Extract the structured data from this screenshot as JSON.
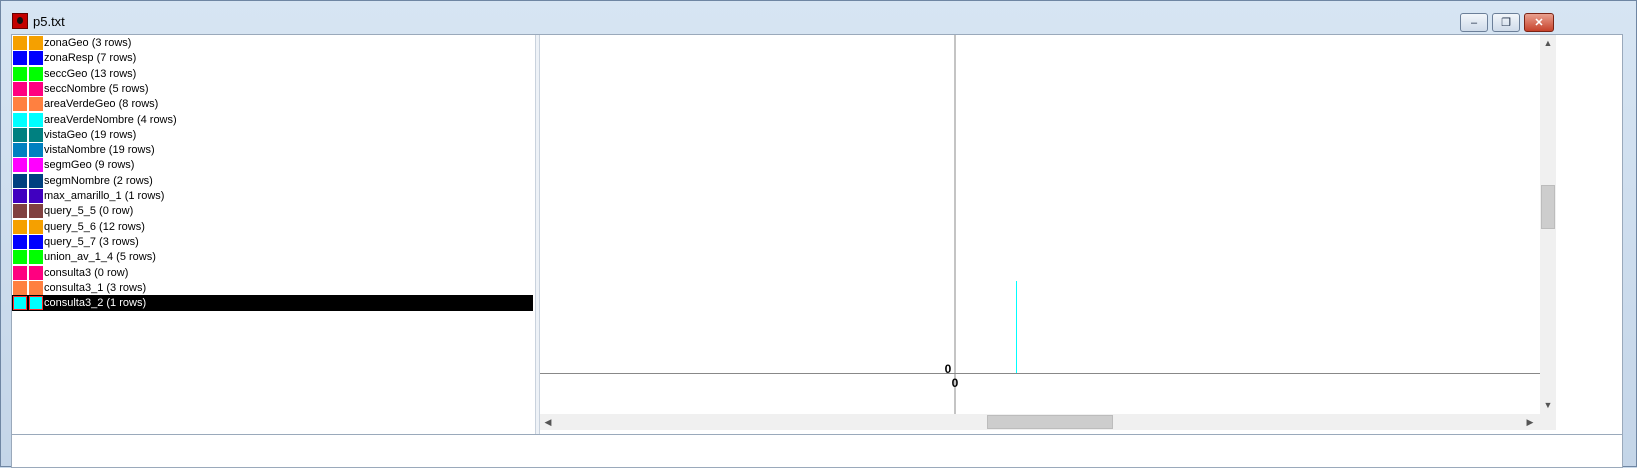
{
  "window": {
    "title": "p5.txt"
  },
  "controls": {
    "minimize": "–",
    "restore": "❐",
    "close": "✕"
  },
  "layers": [
    {
      "label": "zonaGeo (3 rows)",
      "color": "#f5a000"
    },
    {
      "label": "zonaResp (7 rows)",
      "color": "#0000ff"
    },
    {
      "label": "seccGeo (13 rows)",
      "color": "#00ff00"
    },
    {
      "label": "seccNombre (5 rows)",
      "color": "#ff0080"
    },
    {
      "label": "areaVerdeGeo (8 rows)",
      "color": "#ff8040"
    },
    {
      "label": "areaVerdeNombre (4 rows)",
      "color": "#00ffff"
    },
    {
      "label": "vistaGeo (19 rows)",
      "color": "#008080"
    },
    {
      "label": "vistaNombre (19 rows)",
      "color": "#0080c0"
    },
    {
      "label": "segmGeo (9 rows)",
      "color": "#ff00ff"
    },
    {
      "label": "segmNombre (2 rows)",
      "color": "#004080"
    },
    {
      "label": "max_amarillo_1 (1 rows)",
      "color": "#4000c0"
    },
    {
      "label": "query_5_5 (0 row)",
      "color": "#804040"
    },
    {
      "label": "query_5_6 (12 rows)",
      "color": "#f5a000"
    },
    {
      "label": "query_5_7 (3 rows)",
      "color": "#0000ff"
    },
    {
      "label": "union_av_1_4 (5 rows)",
      "color": "#00ff00"
    },
    {
      "label": "consulta3 (0 row)",
      "color": "#ff0080"
    },
    {
      "label": "consulta3_1 (3 rows)",
      "color": "#ff8040"
    },
    {
      "label": "consulta3_2 (1 rows)",
      "color": "#00ffff",
      "selected": true
    }
  ],
  "chart_data": {
    "type": "scatter",
    "title": "",
    "xlabel": "",
    "ylabel": "",
    "x_tick_labels": [
      "0"
    ],
    "y_tick_labels": [
      "0"
    ],
    "series": [
      {
        "color": "#00ffff",
        "x": [
          0
        ],
        "y": [
          0
        ]
      }
    ]
  }
}
